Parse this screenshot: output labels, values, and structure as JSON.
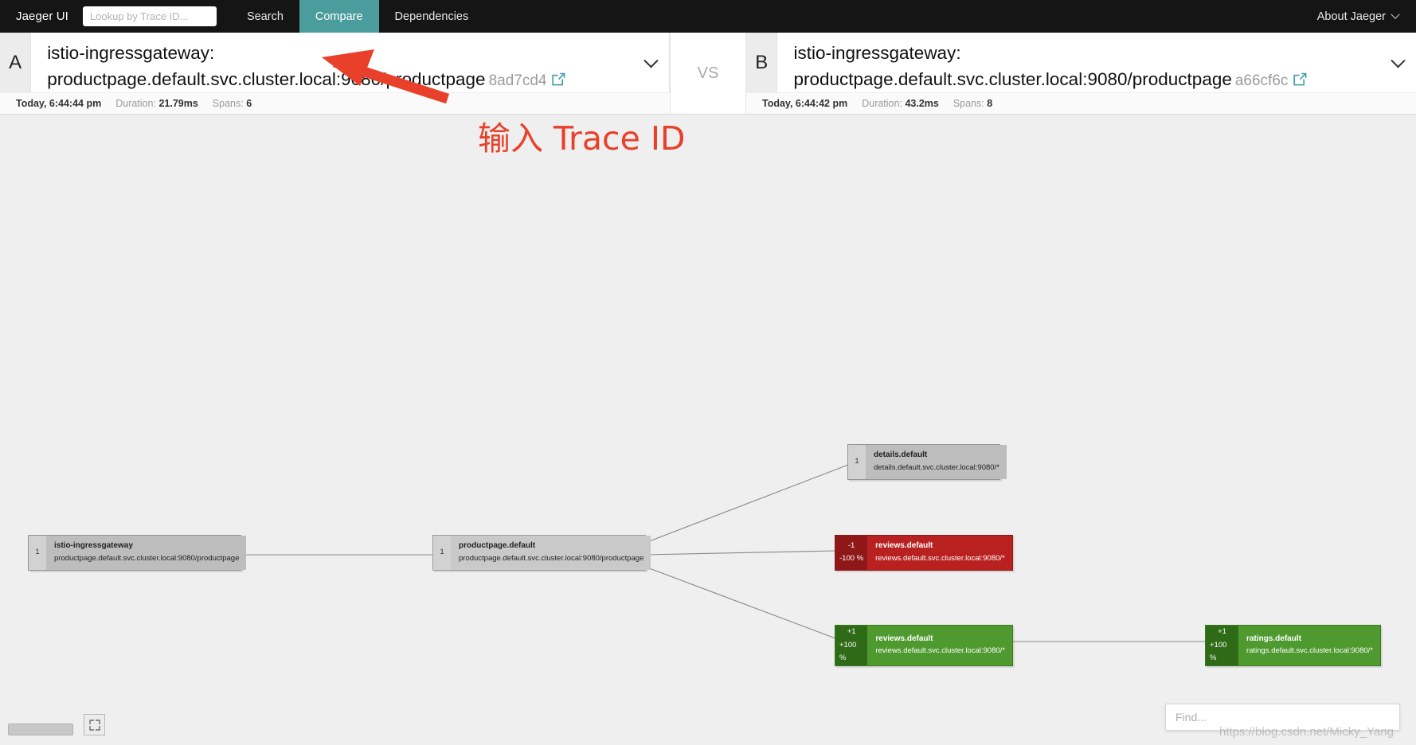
{
  "navbar": {
    "brand": "Jaeger UI",
    "search_placeholder": "Lookup by Trace ID...",
    "search_value": "",
    "links": [
      {
        "label": "Search",
        "active": false
      },
      {
        "label": "Compare",
        "active": true
      },
      {
        "label": "Dependencies",
        "active": false
      }
    ],
    "about": "About Jaeger"
  },
  "comparison": {
    "vs_label": "VS",
    "a": {
      "letter": "A",
      "title": "istio-ingressgateway: productpage.default.svc.cluster.local:9080/productpage",
      "trace_id": "8ad7cd4",
      "timestamp": "Today, 6:44:44 pm",
      "duration_label": "Duration:",
      "duration": "21.79ms",
      "spans_label": "Spans:",
      "spans": "6"
    },
    "b": {
      "letter": "B",
      "title": "istio-ingressgateway: productpage.default.svc.cluster.local:9080/productpage",
      "trace_id": "a66cf6c",
      "timestamp": "Today, 6:44:42 pm",
      "duration_label": "Duration:",
      "duration": "43.2ms",
      "spans_label": "Spans:",
      "spans": "8"
    }
  },
  "graph": {
    "nodes": [
      {
        "id": "istio-ingressgateway",
        "service": "istio-ingressgateway",
        "operation": "productpage.default.svc.cluster.local:9080/productpage",
        "count": "1",
        "delta": "",
        "state": "neutral"
      },
      {
        "id": "productpage-default",
        "service": "productpage.default",
        "operation": "productpage.default.svc.cluster.local:9080/productpage",
        "count": "1",
        "delta": "",
        "state": "neutral"
      },
      {
        "id": "details-default",
        "service": "details.default",
        "operation": "details.default.svc.cluster.local:9080/*",
        "count": "1",
        "delta": "",
        "state": "neutral"
      },
      {
        "id": "reviews-default-removed",
        "service": "reviews.default",
        "operation": "reviews.default.svc.cluster.local:9080/*",
        "count": "-1",
        "delta": "-100 %",
        "state": "negative"
      },
      {
        "id": "reviews-default-added",
        "service": "reviews.default",
        "operation": "reviews.default.svc.cluster.local:9080/*",
        "count": "+1",
        "delta": "+100 %",
        "state": "positive"
      },
      {
        "id": "ratings-default-added",
        "service": "ratings.default",
        "operation": "ratings.default.svc.cluster.local:9080/*",
        "count": "+1",
        "delta": "+100 %",
        "state": "positive"
      }
    ]
  },
  "annotation": {
    "text": "输入 Trace ID",
    "color": "#e8402a"
  },
  "footer": {
    "find_placeholder": "Find...",
    "find_value": "",
    "watermark": "https://blog.csdn.net/Micky_Yang"
  }
}
